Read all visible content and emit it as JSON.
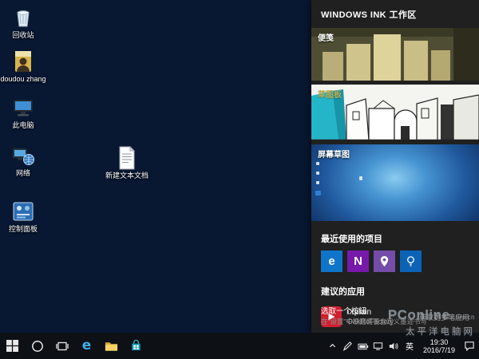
{
  "colors": {
    "taskbar": "#0d1014",
    "panel_background": "#202020",
    "accent_blue": "#0078d7",
    "wallpaper_light": "#8acbf0",
    "wallpaper_dark": "#091c3d",
    "sticky_note": "#cfc48c",
    "suggested_app_icon": "#cf2030"
  },
  "desktop": {
    "icons": [
      {
        "label": "回收站"
      },
      {
        "label": "doudou zhang"
      },
      {
        "label": "此电脑"
      },
      {
        "label": "网络"
      },
      {
        "label": "控制面板"
      }
    ],
    "file_label": "新建文本文档"
  },
  "ink": {
    "title": "WINDOWS INK 工作区",
    "tiles": [
      {
        "label": "便笺"
      },
      {
        "label": "草图板"
      },
      {
        "label": "屏幕草图"
      }
    ],
    "recent_title": "最近使用的项目",
    "recent_apps": [
      {
        "name": "edge",
        "glyph": "e"
      },
      {
        "name": "onenote",
        "glyph": "N"
      },
      {
        "name": "maps",
        "glyph": ""
      },
      {
        "name": "tips",
        "glyph": ""
      }
    ],
    "suggested_title": "建议的应用",
    "suggested_app": {
      "name": "iXplain",
      "publisher": "OakReFactory"
    },
    "more_apps": "获取更多笔应用",
    "hint_line1": "选取一个按钮",
    "hint_line2": "在“设置”中根据需要自定义墨迹书写"
  },
  "taskbar": {
    "time": "19:30",
    "date": "2016/7/19",
    "input_indicator": "英"
  },
  "watermark": {
    "brand": "PConline",
    "brand_suffix": ".com.cn",
    "subtitle": "太平洋电脑网"
  }
}
